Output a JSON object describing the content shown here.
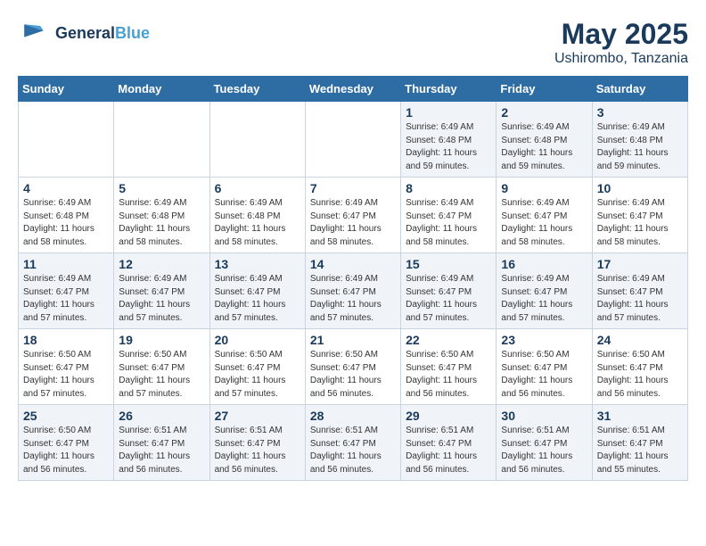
{
  "logo": {
    "name_line1": "General",
    "name_line2": "Blue"
  },
  "title": "May 2025",
  "subtitle": "Ushirombo, Tanzania",
  "days_of_week": [
    "Sunday",
    "Monday",
    "Tuesday",
    "Wednesday",
    "Thursday",
    "Friday",
    "Saturday"
  ],
  "weeks": [
    [
      {
        "day": "",
        "info": ""
      },
      {
        "day": "",
        "info": ""
      },
      {
        "day": "",
        "info": ""
      },
      {
        "day": "",
        "info": ""
      },
      {
        "day": "1",
        "info": "Sunrise: 6:49 AM\nSunset: 6:48 PM\nDaylight: 11 hours\nand 59 minutes."
      },
      {
        "day": "2",
        "info": "Sunrise: 6:49 AM\nSunset: 6:48 PM\nDaylight: 11 hours\nand 59 minutes."
      },
      {
        "day": "3",
        "info": "Sunrise: 6:49 AM\nSunset: 6:48 PM\nDaylight: 11 hours\nand 59 minutes."
      }
    ],
    [
      {
        "day": "4",
        "info": "Sunrise: 6:49 AM\nSunset: 6:48 PM\nDaylight: 11 hours\nand 58 minutes."
      },
      {
        "day": "5",
        "info": "Sunrise: 6:49 AM\nSunset: 6:48 PM\nDaylight: 11 hours\nand 58 minutes."
      },
      {
        "day": "6",
        "info": "Sunrise: 6:49 AM\nSunset: 6:48 PM\nDaylight: 11 hours\nand 58 minutes."
      },
      {
        "day": "7",
        "info": "Sunrise: 6:49 AM\nSunset: 6:47 PM\nDaylight: 11 hours\nand 58 minutes."
      },
      {
        "day": "8",
        "info": "Sunrise: 6:49 AM\nSunset: 6:47 PM\nDaylight: 11 hours\nand 58 minutes."
      },
      {
        "day": "9",
        "info": "Sunrise: 6:49 AM\nSunset: 6:47 PM\nDaylight: 11 hours\nand 58 minutes."
      },
      {
        "day": "10",
        "info": "Sunrise: 6:49 AM\nSunset: 6:47 PM\nDaylight: 11 hours\nand 58 minutes."
      }
    ],
    [
      {
        "day": "11",
        "info": "Sunrise: 6:49 AM\nSunset: 6:47 PM\nDaylight: 11 hours\nand 57 minutes."
      },
      {
        "day": "12",
        "info": "Sunrise: 6:49 AM\nSunset: 6:47 PM\nDaylight: 11 hours\nand 57 minutes."
      },
      {
        "day": "13",
        "info": "Sunrise: 6:49 AM\nSunset: 6:47 PM\nDaylight: 11 hours\nand 57 minutes."
      },
      {
        "day": "14",
        "info": "Sunrise: 6:49 AM\nSunset: 6:47 PM\nDaylight: 11 hours\nand 57 minutes."
      },
      {
        "day": "15",
        "info": "Sunrise: 6:49 AM\nSunset: 6:47 PM\nDaylight: 11 hours\nand 57 minutes."
      },
      {
        "day": "16",
        "info": "Sunrise: 6:49 AM\nSunset: 6:47 PM\nDaylight: 11 hours\nand 57 minutes."
      },
      {
        "day": "17",
        "info": "Sunrise: 6:49 AM\nSunset: 6:47 PM\nDaylight: 11 hours\nand 57 minutes."
      }
    ],
    [
      {
        "day": "18",
        "info": "Sunrise: 6:50 AM\nSunset: 6:47 PM\nDaylight: 11 hours\nand 57 minutes."
      },
      {
        "day": "19",
        "info": "Sunrise: 6:50 AM\nSunset: 6:47 PM\nDaylight: 11 hours\nand 57 minutes."
      },
      {
        "day": "20",
        "info": "Sunrise: 6:50 AM\nSunset: 6:47 PM\nDaylight: 11 hours\nand 57 minutes."
      },
      {
        "day": "21",
        "info": "Sunrise: 6:50 AM\nSunset: 6:47 PM\nDaylight: 11 hours\nand 56 minutes."
      },
      {
        "day": "22",
        "info": "Sunrise: 6:50 AM\nSunset: 6:47 PM\nDaylight: 11 hours\nand 56 minutes."
      },
      {
        "day": "23",
        "info": "Sunrise: 6:50 AM\nSunset: 6:47 PM\nDaylight: 11 hours\nand 56 minutes."
      },
      {
        "day": "24",
        "info": "Sunrise: 6:50 AM\nSunset: 6:47 PM\nDaylight: 11 hours\nand 56 minutes."
      }
    ],
    [
      {
        "day": "25",
        "info": "Sunrise: 6:50 AM\nSunset: 6:47 PM\nDaylight: 11 hours\nand 56 minutes."
      },
      {
        "day": "26",
        "info": "Sunrise: 6:51 AM\nSunset: 6:47 PM\nDaylight: 11 hours\nand 56 minutes."
      },
      {
        "day": "27",
        "info": "Sunrise: 6:51 AM\nSunset: 6:47 PM\nDaylight: 11 hours\nand 56 minutes."
      },
      {
        "day": "28",
        "info": "Sunrise: 6:51 AM\nSunset: 6:47 PM\nDaylight: 11 hours\nand 56 minutes."
      },
      {
        "day": "29",
        "info": "Sunrise: 6:51 AM\nSunset: 6:47 PM\nDaylight: 11 hours\nand 56 minutes."
      },
      {
        "day": "30",
        "info": "Sunrise: 6:51 AM\nSunset: 6:47 PM\nDaylight: 11 hours\nand 56 minutes."
      },
      {
        "day": "31",
        "info": "Sunrise: 6:51 AM\nSunset: 6:47 PM\nDaylight: 11 hours\nand 55 minutes."
      }
    ]
  ]
}
